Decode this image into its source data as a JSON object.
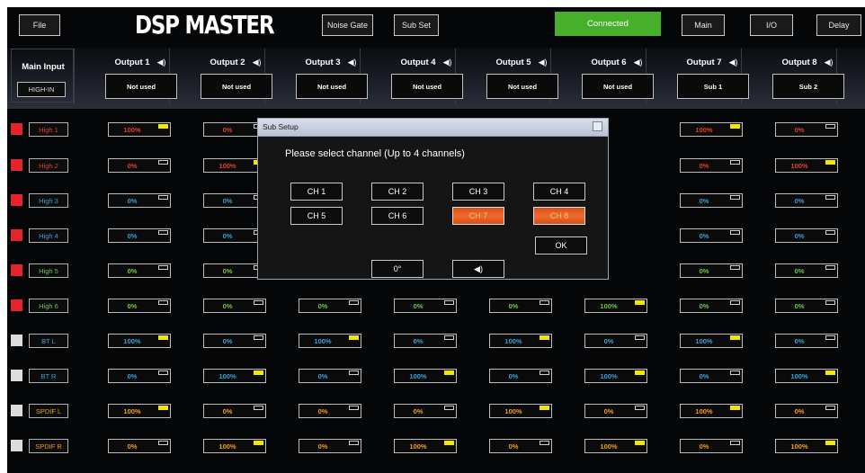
{
  "topbar": {
    "file": "File",
    "brand": "DSP MASTER",
    "noise_gate": "Noise Gate",
    "sub_set": "Sub Set",
    "connected": "Connected",
    "main": "Main",
    "io": "I/O",
    "delay": "Delay"
  },
  "main_input": {
    "title": "Main Input",
    "value": "HIGH-IN"
  },
  "outputs": [
    {
      "label": "Output 1",
      "assign": "Not used"
    },
    {
      "label": "Output 2",
      "assign": "Not used"
    },
    {
      "label": "Output 3",
      "assign": "Not used"
    },
    {
      "label": "Output 4",
      "assign": "Not used"
    },
    {
      "label": "Output 5",
      "assign": "Not used"
    },
    {
      "label": "Output 6",
      "assign": "Not used"
    },
    {
      "label": "Output 7",
      "assign": "Sub 1"
    },
    {
      "label": "Output 8",
      "assign": "Sub 2"
    }
  ],
  "speaker_glyph": "◀)",
  "colors": {
    "accent_connected": "#47b02a",
    "selected_channel": "#f06a2c",
    "active_flag": "#f2e60a"
  },
  "inputs": [
    {
      "label": "High 1",
      "indicator": "#e5232b",
      "text_color": "#e0412e",
      "cells": [
        "100%",
        "0%",
        "",
        "",
        "",
        "",
        "100%",
        "0%"
      ],
      "on": [
        1,
        0,
        0,
        0,
        0,
        0,
        1,
        0
      ]
    },
    {
      "label": "High 2",
      "indicator": "#e5232b",
      "text_color": "#e0412e",
      "cells": [
        "0%",
        "100%",
        "",
        "",
        "",
        "",
        "0%",
        "100%"
      ],
      "on": [
        0,
        1,
        0,
        0,
        0,
        0,
        0,
        1
      ]
    },
    {
      "label": "High 3",
      "indicator": "#e5232b",
      "text_color": "#3aa0d8",
      "cells": [
        "0%",
        "0%",
        "",
        "",
        "",
        "",
        "0%",
        "0%"
      ],
      "on": [
        0,
        0,
        0,
        0,
        0,
        0,
        0,
        0
      ]
    },
    {
      "label": "High 4",
      "indicator": "#e5232b",
      "text_color": "#3aa0d8",
      "cells": [
        "0%",
        "0%",
        "",
        "",
        "",
        "",
        "0%",
        "0%"
      ],
      "on": [
        0,
        0,
        0,
        0,
        0,
        0,
        0,
        0
      ]
    },
    {
      "label": "High 5",
      "indicator": "#e5232b",
      "text_color": "#72c44a",
      "cells": [
        "0%",
        "0%",
        "",
        "",
        "",
        "",
        "0%",
        "0%"
      ],
      "on": [
        0,
        0,
        0,
        0,
        0,
        0,
        0,
        0
      ]
    },
    {
      "label": "High 6",
      "indicator": "#e5232b",
      "text_color": "#72c44a",
      "cells": [
        "0%",
        "0%",
        "0%",
        "0%",
        "0%",
        "100%",
        "0%",
        "0%"
      ],
      "on": [
        0,
        0,
        0,
        0,
        0,
        1,
        0,
        0
      ]
    },
    {
      "label": "BT L",
      "indicator": "#dcdcdc",
      "text_color": "#3aa0d8",
      "cells": [
        "100%",
        "0%",
        "100%",
        "0%",
        "100%",
        "0%",
        "100%",
        "0%"
      ],
      "on": [
        1,
        0,
        1,
        0,
        1,
        0,
        1,
        0
      ]
    },
    {
      "label": "BT R",
      "indicator": "#dcdcdc",
      "text_color": "#3aa0d8",
      "cells": [
        "0%",
        "100%",
        "0%",
        "100%",
        "0%",
        "100%",
        "0%",
        "100%"
      ],
      "on": [
        0,
        1,
        0,
        1,
        0,
        1,
        0,
        1
      ]
    },
    {
      "label": "SPDIF L",
      "indicator": "#dcdcdc",
      "text_color": "#f0a020",
      "cells": [
        "100%",
        "0%",
        "0%",
        "0%",
        "100%",
        "0%",
        "100%",
        "0%"
      ],
      "on": [
        1,
        0,
        0,
        0,
        1,
        0,
        1,
        0
      ]
    },
    {
      "label": "SPDIF R",
      "indicator": "#dcdcdc",
      "text_color": "#f0a020",
      "cells": [
        "0%",
        "100%",
        "0%",
        "100%",
        "0%",
        "100%",
        "0%",
        "100%"
      ],
      "on": [
        0,
        1,
        0,
        1,
        0,
        1,
        0,
        1
      ]
    }
  ],
  "dialog": {
    "title": "Sub Setup",
    "prompt": "Please select channel (Up to 4 channels)",
    "channels": [
      {
        "label": "CH 1",
        "selected": false
      },
      {
        "label": "CH 2",
        "selected": false
      },
      {
        "label": "CH 3",
        "selected": false
      },
      {
        "label": "CH 4",
        "selected": false
      },
      {
        "label": "CH 5",
        "selected": false
      },
      {
        "label": "CH 6",
        "selected": false
      },
      {
        "label": "CH 7",
        "selected": true
      },
      {
        "label": "CH 8",
        "selected": true
      }
    ],
    "ok": "OK",
    "phase": "0°",
    "mute_glyph": "◀)"
  }
}
